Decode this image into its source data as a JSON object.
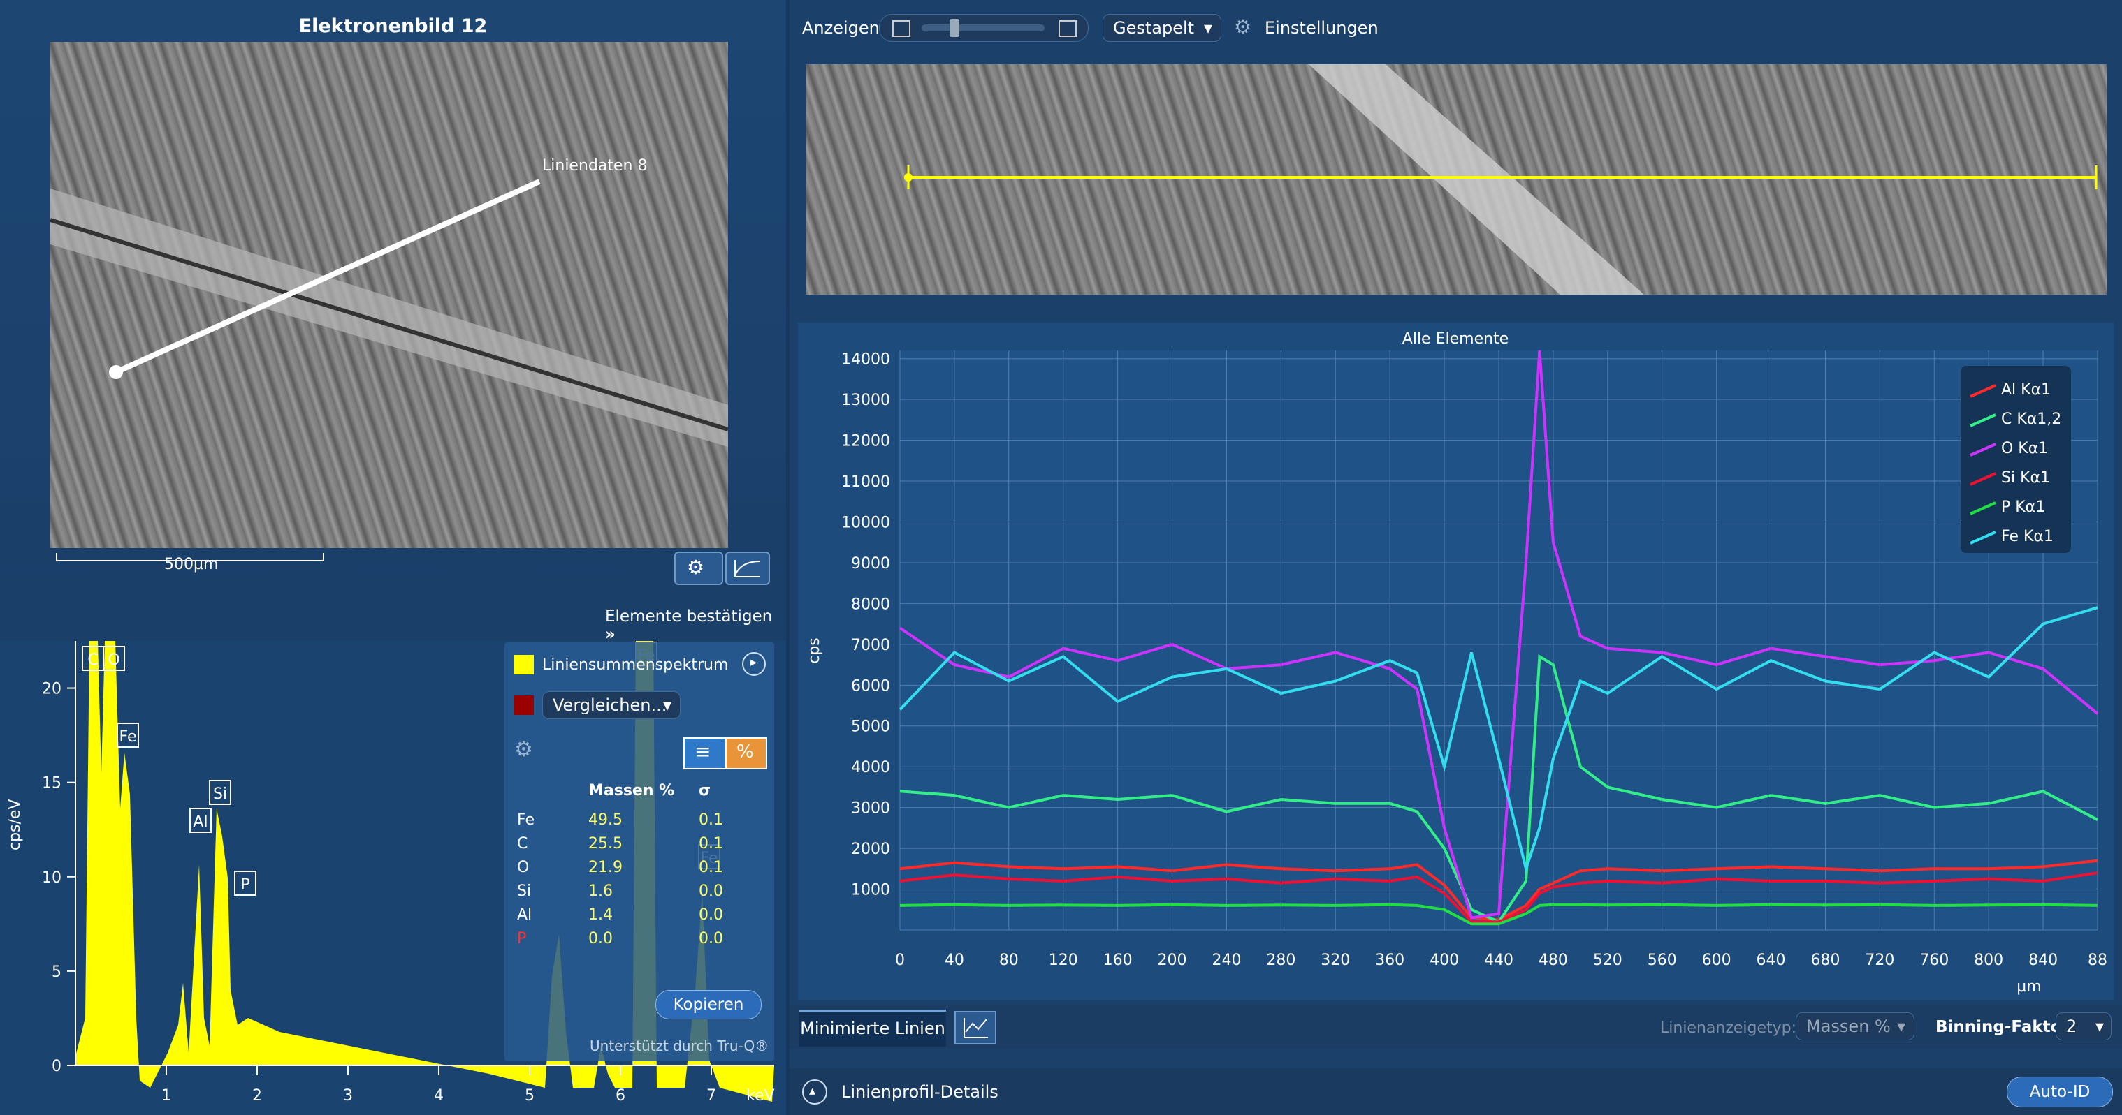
{
  "electron_image": {
    "title": "Elektronenbild 12",
    "line_label": "Liniendaten 8",
    "scale_label": "500µm"
  },
  "spectrum": {
    "confirm_label": "Elemente bestätigen",
    "y_axis_label": "cps/eV",
    "x_axis_unit": "keV",
    "y_ticks": [
      "20",
      "15",
      "10",
      "5",
      "0"
    ],
    "x_ticks": [
      "1",
      "2",
      "3",
      "4",
      "5",
      "6",
      "7"
    ],
    "peak_labels": [
      "C",
      "O",
      "Fe",
      "Al",
      "Si",
      "P",
      "Fe",
      "Fe"
    ],
    "legend_primary": "Liniensummenspektrum",
    "legend_compare": "Vergleichen...",
    "table_headers": [
      "Massen %",
      "σ"
    ],
    "table_rows": [
      {
        "el": "Fe",
        "mass": "49.5",
        "sigma": "0.1"
      },
      {
        "el": "C",
        "mass": "25.5",
        "sigma": "0.1"
      },
      {
        "el": "O",
        "mass": "21.9",
        "sigma": "0.1"
      },
      {
        "el": "Si",
        "mass": "1.6",
        "sigma": "0.0"
      },
      {
        "el": "Al",
        "mass": "1.4",
        "sigma": "0.0"
      },
      {
        "el": "P",
        "mass": "0.0",
        "sigma": "0.0"
      }
    ],
    "copy_button": "Kopieren",
    "footer": "Unterstützt durch Tru-Q®",
    "colors": {
      "spectrum": "#ffff00",
      "compare": "#990000",
      "highlight": "#e8953a"
    }
  },
  "toolbar": {
    "view_label": "Anzeigen",
    "layout_select": "Gestapelt",
    "settings_label": "Einstellungen"
  },
  "line_chart": {
    "title": "Alle Elemente",
    "y_label": "cps",
    "x_unit": "µm",
    "y_ticks": [
      "14000",
      "13000",
      "12000",
      "11000",
      "10000",
      "9000",
      "8000",
      "7000",
      "6000",
      "5000",
      "4000",
      "3000",
      "2000",
      "1000"
    ],
    "x_ticks": [
      "0",
      "40",
      "80",
      "120",
      "160",
      "200",
      "240",
      "280",
      "320",
      "360",
      "400",
      "440",
      "480",
      "520",
      "560",
      "600",
      "640",
      "680",
      "720",
      "760",
      "800",
      "840",
      "88"
    ]
  },
  "chart_data": {
    "type": "line",
    "title": "Alle Elemente",
    "xlabel": "µm",
    "ylabel": "cps",
    "xlim": [
      0,
      880
    ],
    "ylim": [
      0,
      14200
    ],
    "grid": true,
    "legend_position": "top-right",
    "x": [
      0,
      40,
      80,
      120,
      160,
      200,
      240,
      280,
      320,
      360,
      380,
      400,
      420,
      440,
      460,
      470,
      480,
      500,
      520,
      560,
      600,
      640,
      680,
      720,
      760,
      800,
      840,
      880
    ],
    "series": [
      {
        "name": "Al Kα1",
        "color": "#ff2a2a",
        "values": [
          1500,
          1650,
          1550,
          1500,
          1550,
          1450,
          1600,
          1500,
          1450,
          1500,
          1600,
          1100,
          300,
          250,
          600,
          1000,
          1150,
          1450,
          1500,
          1450,
          1500,
          1550,
          1500,
          1450,
          1500,
          1500,
          1550,
          1700
        ]
      },
      {
        "name": "C Kα1,2",
        "color": "#33ee88",
        "values": [
          3400,
          3300,
          3000,
          3300,
          3200,
          3300,
          2900,
          3200,
          3100,
          3100,
          2900,
          2000,
          500,
          200,
          1200,
          6700,
          6500,
          4000,
          3500,
          3200,
          3000,
          3300,
          3100,
          3300,
          3000,
          3100,
          3400,
          2700
        ]
      },
      {
        "name": "O Kα1",
        "color": "#cc33ff",
        "values": [
          7400,
          6500,
          6200,
          6900,
          6600,
          7000,
          6400,
          6500,
          6800,
          6400,
          5900,
          2500,
          300,
          400,
          9000,
          14200,
          9500,
          7200,
          6900,
          6800,
          6500,
          6900,
          6700,
          6500,
          6600,
          6800,
          6400,
          5300
        ]
      },
      {
        "name": "Si Kα1",
        "color": "#ee1133",
        "values": [
          1200,
          1350,
          1250,
          1200,
          1300,
          1200,
          1250,
          1150,
          1250,
          1200,
          1300,
          900,
          200,
          200,
          500,
          900,
          1050,
          1150,
          1200,
          1150,
          1250,
          1200,
          1200,
          1150,
          1200,
          1250,
          1200,
          1400
        ]
      },
      {
        "name": "P Kα1",
        "color": "#22dd44",
        "values": [
          600,
          620,
          600,
          610,
          600,
          620,
          600,
          610,
          600,
          620,
          600,
          500,
          150,
          150,
          400,
          600,
          620,
          620,
          610,
          620,
          600,
          620,
          610,
          620,
          600,
          610,
          620,
          600
        ]
      },
      {
        "name": "Fe Kα1",
        "color": "#33ddee",
        "values": [
          5400,
          6800,
          6100,
          6700,
          5600,
          6200,
          6400,
          5800,
          6100,
          6600,
          6300,
          4000,
          6800,
          4200,
          1500,
          2500,
          4200,
          6100,
          5800,
          6700,
          5900,
          6600,
          6100,
          5900,
          6800,
          6200,
          7500,
          7900
        ]
      }
    ]
  },
  "bottom_bar": {
    "tab_label": "Minimierte Linien",
    "line_type_label": "Linienanzeigetyp:",
    "line_type_value": "Massen %",
    "binning_label": "Binning-Faktor:",
    "binning_value": "2"
  },
  "details_bar": {
    "label": "Linienprofil-Details",
    "auto_id": "Auto-ID"
  }
}
